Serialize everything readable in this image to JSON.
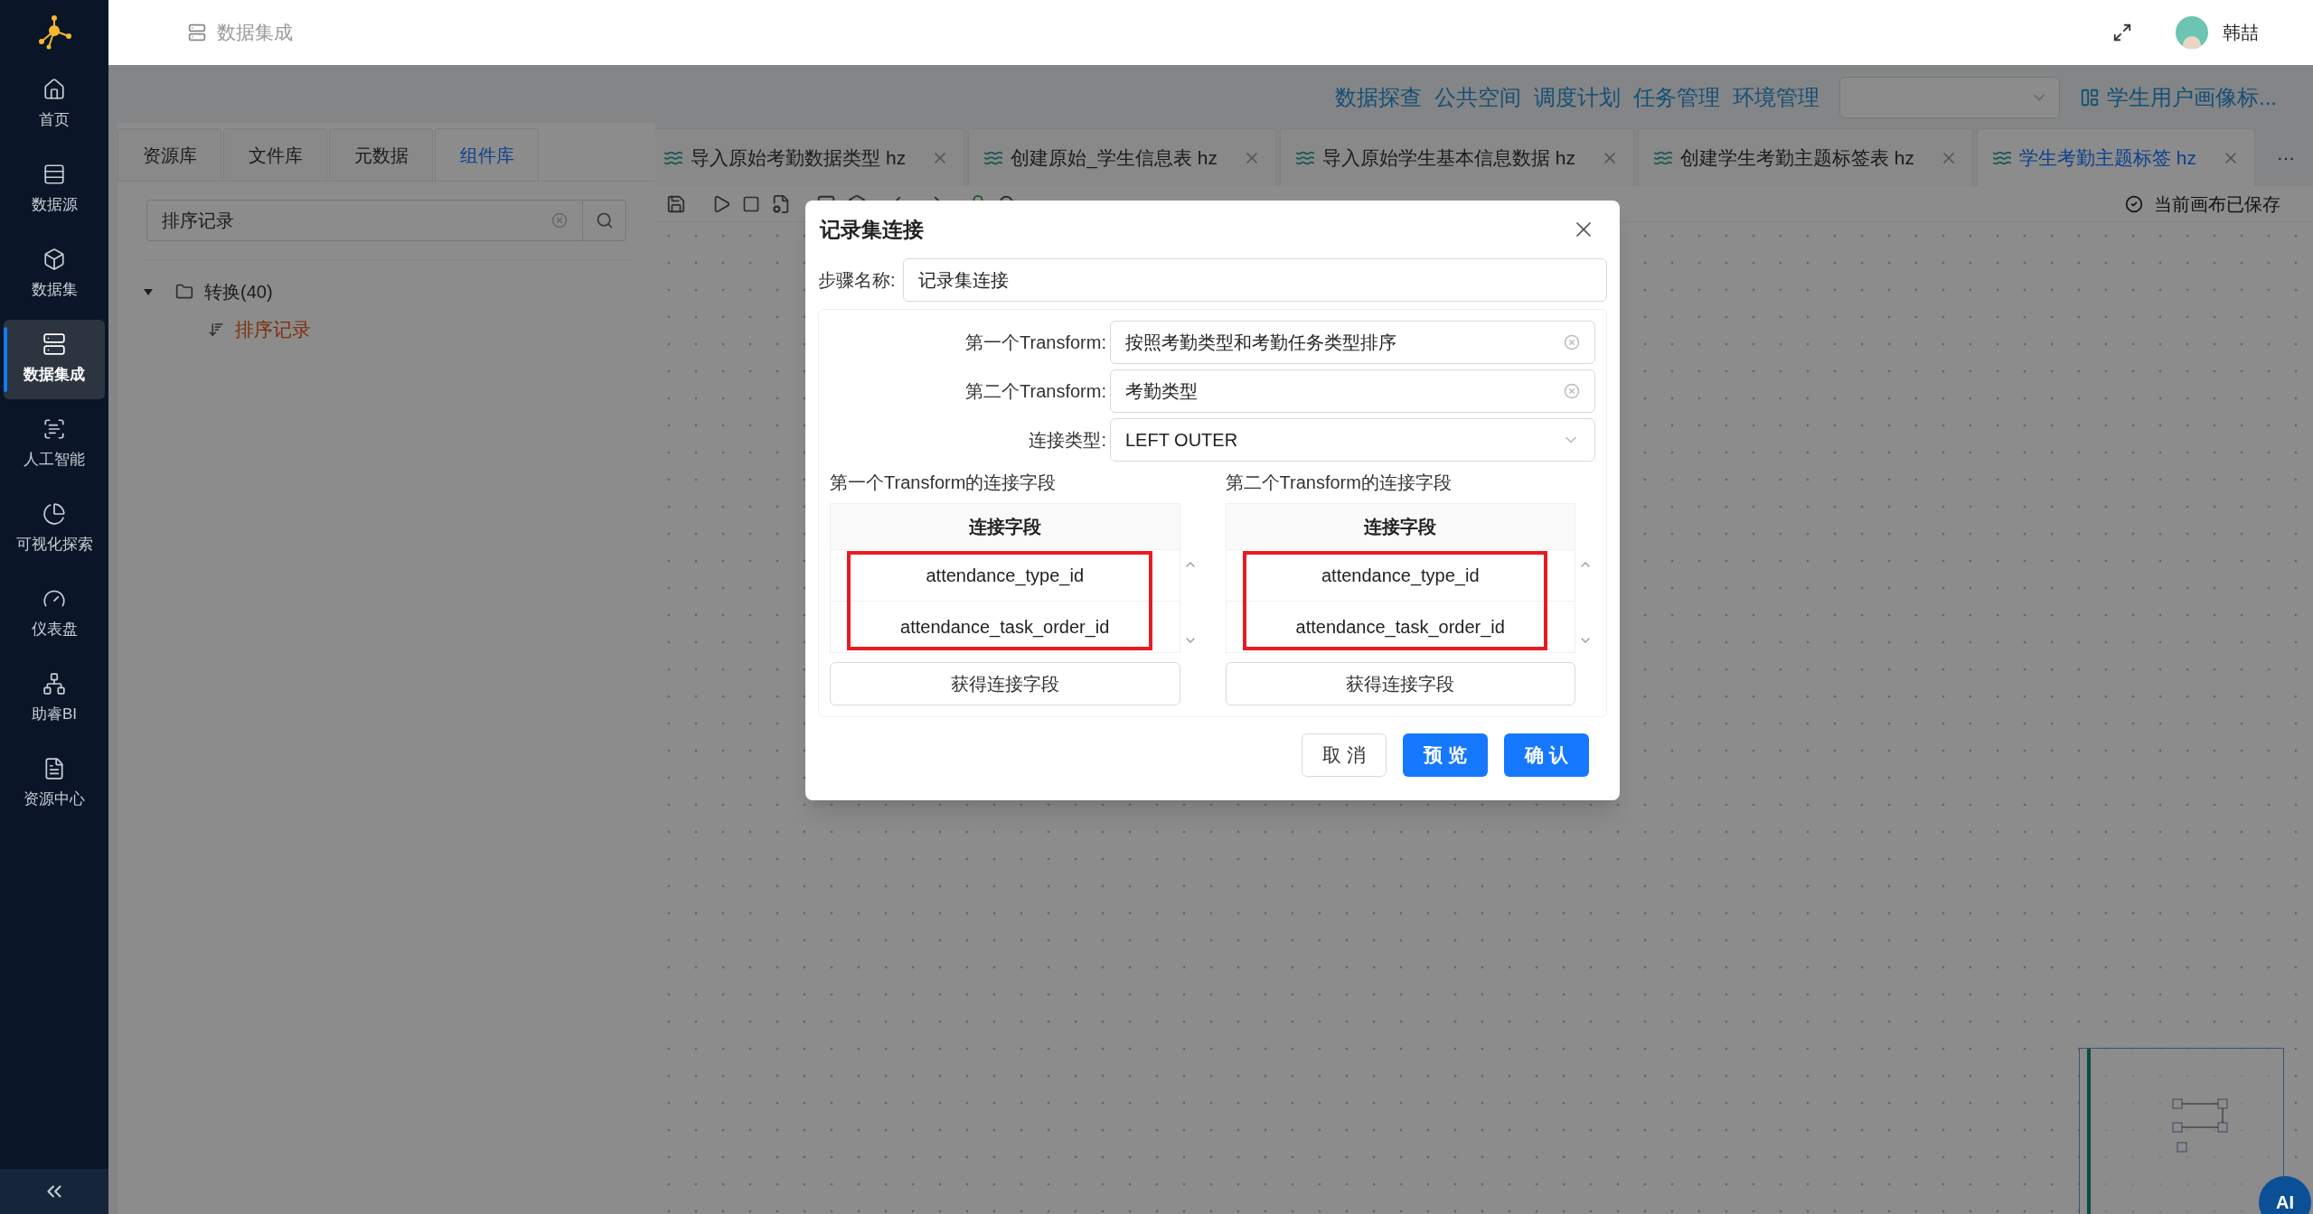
{
  "header": {
    "breadcrumb": "数据集成",
    "user": "韩喆"
  },
  "sidebar": {
    "items": [
      {
        "label": "首页",
        "kind": "home",
        "selected": false
      },
      {
        "label": "数据源",
        "kind": "source",
        "selected": false
      },
      {
        "label": "数据集",
        "kind": "dataset",
        "selected": false
      },
      {
        "label": "数据集成",
        "kind": "integration",
        "selected": true
      },
      {
        "label": "人工智能",
        "kind": "ai",
        "selected": false
      },
      {
        "label": "可视化探索",
        "kind": "chart",
        "selected": false
      },
      {
        "label": "仪表盘",
        "kind": "gauge",
        "selected": false
      },
      {
        "label": "助睿BI",
        "kind": "bi",
        "selected": false
      },
      {
        "label": "资源中心",
        "kind": "resource",
        "selected": false
      }
    ]
  },
  "nav_links": [
    "数据探查",
    "公共空间",
    "调度计划",
    "任务管理",
    "环境管理"
  ],
  "project_link": "学生用户画像标...",
  "left_panel": {
    "tabs": [
      {
        "label": "资源库",
        "selected": false
      },
      {
        "label": "文件库",
        "selected": false
      },
      {
        "label": "元数据",
        "selected": false
      },
      {
        "label": "组件库",
        "selected": true
      }
    ],
    "search": {
      "value": "排序记录"
    },
    "tree": [
      {
        "label": "转换(40)",
        "expanded": true,
        "children": [
          {
            "label": "排序记录",
            "selected": true
          }
        ]
      }
    ]
  },
  "editor_tabs": [
    {
      "label": "导入原始考勤数据类型 hz",
      "selected": false
    },
    {
      "label": "创建原始_学生信息表 hz",
      "selected": false
    },
    {
      "label": "导入原始学生基本信息数据 hz",
      "selected": false
    },
    {
      "label": "创建学生考勤主题标签表 hz",
      "selected": false
    },
    {
      "label": "学生考勤主题标签 hz",
      "selected": true
    }
  ],
  "more_tabs": "···",
  "save_status": "当前画布已保存",
  "assistant_button": "AI",
  "dialog": {
    "title": "记录集连接",
    "step_label": "步骤名称:",
    "step_value": "记录集连接",
    "fields": [
      {
        "label": "第一个Transform:",
        "value": "按照考勤类型和考勤任务类型排序",
        "kind": "clearable"
      },
      {
        "label": "第二个Transform:",
        "value": "考勤类型",
        "kind": "clearable"
      },
      {
        "label": "连接类型:",
        "value": "LEFT OUTER",
        "kind": "dropdown"
      }
    ],
    "tables": [
      {
        "title": "第一个Transform的连接字段",
        "header": "连接字段",
        "rows": [
          "attendance_type_id",
          "attendance_task_order_id"
        ],
        "button": "获得连接字段",
        "highlighted": true
      },
      {
        "title": "第二个Transform的连接字段",
        "header": "连接字段",
        "rows": [
          "attendance_type_id",
          "attendance_task_order_id"
        ],
        "button": "获得连接字段",
        "highlighted": true
      }
    ],
    "buttons": [
      {
        "label": "取 消",
        "kind": "default"
      },
      {
        "label": "预 览",
        "kind": "primary"
      },
      {
        "label": "确 认",
        "kind": "primary"
      }
    ]
  }
}
